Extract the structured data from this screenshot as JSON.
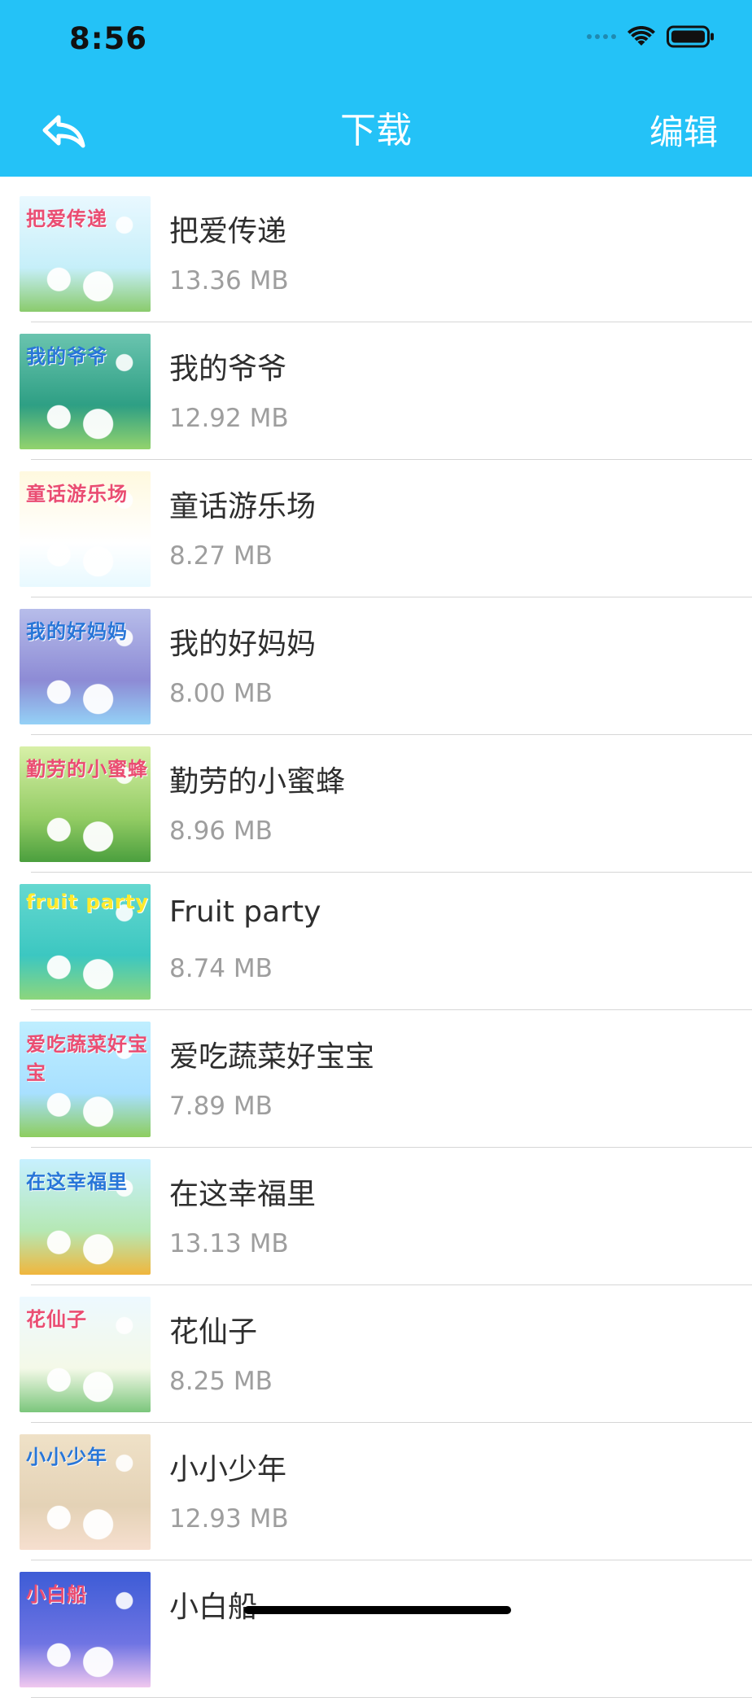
{
  "status_bar": {
    "time": "8:56"
  },
  "nav": {
    "title": "下载",
    "edit_label": "编辑"
  },
  "downloads": [
    {
      "title": "把爱传递",
      "size": "13.36 MB",
      "thumb_text": "把爱传递",
      "colors": [
        "#e9f8ff",
        "#c6eff9",
        "#8acb6c"
      ]
    },
    {
      "title": "我的爷爷",
      "size": "12.92 MB",
      "thumb_text": "我的爷爷",
      "colors": [
        "#6ac4af",
        "#2e9f84",
        "#93d36d"
      ]
    },
    {
      "title": "童话游乐场",
      "size": "8.27 MB",
      "thumb_text": "童话游乐场",
      "colors": [
        "#fff9df",
        "#ffffff",
        "#e8f9ff"
      ]
    },
    {
      "title": "我的好妈妈",
      "size": "8.00 MB",
      "thumb_text": "我的好妈妈",
      "colors": [
        "#b7bdea",
        "#8d8bd5",
        "#94d1f6"
      ]
    },
    {
      "title": "勤劳的小蜜蜂",
      "size": "8.96 MB",
      "thumb_text": "勤劳的小蜜蜂",
      "colors": [
        "#d8f0a8",
        "#93cc64",
        "#4b9f3e"
      ]
    },
    {
      "title": "Fruit party",
      "size": "8.74 MB",
      "thumb_text": "fruit party",
      "colors": [
        "#65d8d0",
        "#3cc7c1",
        "#8dd67c"
      ]
    },
    {
      "title": "爱吃蔬菜好宝宝",
      "size": "7.89 MB",
      "thumb_text": "爱吃蔬菜好宝宝",
      "colors": [
        "#bfeeff",
        "#a8e0ff",
        "#8dcd5e"
      ]
    },
    {
      "title": "在这幸福里",
      "size": "13.13 MB",
      "thumb_text": "在这幸福里",
      "colors": [
        "#c7f0ff",
        "#b5e8b4",
        "#f0b63d"
      ]
    },
    {
      "title": "花仙子",
      "size": "8.25 MB",
      "thumb_text": "花仙子",
      "colors": [
        "#edf9ff",
        "#f4f9e8",
        "#7bc67c"
      ]
    },
    {
      "title": "小小少年",
      "size": "12.93 MB",
      "thumb_text": "小小少年",
      "colors": [
        "#efe1c7",
        "#e4d2b6",
        "#f6dfcf"
      ]
    },
    {
      "title": "小白船",
      "size": "",
      "thumb_text": "小白船",
      "colors": [
        "#3d5cd6",
        "#6f74e3",
        "#f1c8ef"
      ]
    }
  ]
}
